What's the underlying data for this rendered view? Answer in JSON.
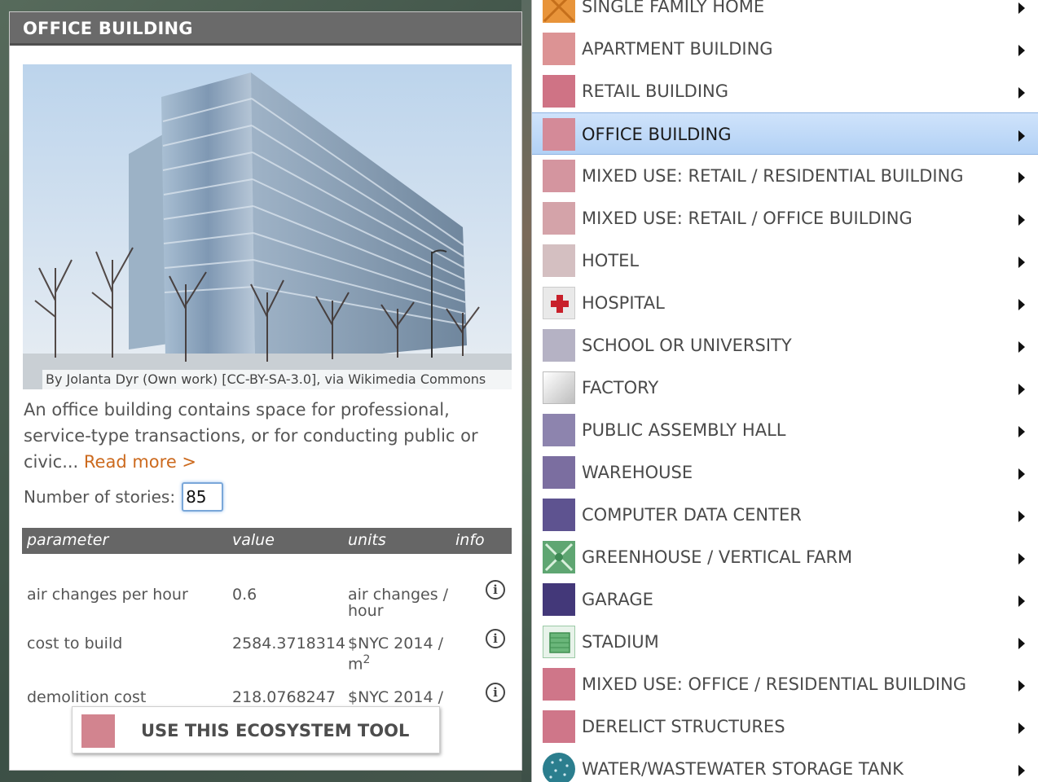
{
  "panel": {
    "title": "OFFICE BUILDING",
    "photo_credit": "By Jolanta Dyr (Own work) [CC-BY-SA-3.0], via Wikimedia Commons",
    "description": "An office building contains space for professional, service-type transactions, or for conducting public or civic...",
    "read_more": "Read more >",
    "stories_label": "Number of stories:",
    "stories_value": "85",
    "table": {
      "headers": [
        "parameter",
        "value",
        "units",
        "info"
      ],
      "rows": [
        {
          "parameter": "air changes per hour",
          "value": "0.6",
          "units_line1": "air changes /",
          "units_line2": "hour"
        },
        {
          "parameter": "cost to build",
          "value": "2584.3718314",
          "units_line1": "$NYC 2014 /",
          "units_line2": "m",
          "units_sup": "2"
        },
        {
          "parameter": "demolition cost",
          "value": "218.0768247",
          "units_line1": "$NYC 2014 /",
          "units_line2": ""
        }
      ]
    },
    "use_tool_label": "USE THIS ECOSYSTEM TOOL",
    "use_tool_color": "#d2848f"
  },
  "menu": {
    "items": [
      {
        "label": "SINGLE FAMILY HOME",
        "color": "#e8943a",
        "icon": "house-icon"
      },
      {
        "label": "APARTMENT BUILDING",
        "color": "#dc9394",
        "icon": "swatch"
      },
      {
        "label": "RETAIL BUILDING",
        "color": "#cf7385",
        "icon": "swatch"
      },
      {
        "label": "OFFICE BUILDING",
        "color": "#d48a98",
        "icon": "swatch",
        "selected": true
      },
      {
        "label": "MIXED USE: RETAIL / RESIDENTIAL BUILDING",
        "color": "#d4959f",
        "icon": "swatch"
      },
      {
        "label": "MIXED USE: RETAIL / OFFICE BUILDING",
        "color": "#d4a3a9",
        "icon": "swatch"
      },
      {
        "label": "HOTEL",
        "color": "#d4bfc1",
        "icon": "swatch"
      },
      {
        "label": "HOSPITAL",
        "color": "#e9e9e9",
        "icon": "red-cross-icon"
      },
      {
        "label": "SCHOOL OR UNIVERSITY",
        "color": "#b5b2c4",
        "icon": "swatch"
      },
      {
        "label": "FACTORY",
        "color": "#e2e2e2",
        "icon": "gradient"
      },
      {
        "label": "PUBLIC ASSEMBLY HALL",
        "color": "#8d84ae",
        "icon": "swatch"
      },
      {
        "label": "WAREHOUSE",
        "color": "#7b6ea0",
        "icon": "swatch"
      },
      {
        "label": "COMPUTER DATA CENTER",
        "color": "#5e5390",
        "icon": "swatch"
      },
      {
        "label": "GREENHOUSE / VERTICAL FARM",
        "color": "#5fa672",
        "icon": "greenhouse-icon"
      },
      {
        "label": "GARAGE",
        "color": "#433879",
        "icon": "swatch"
      },
      {
        "label": "STADIUM",
        "color": "#6ab67a",
        "icon": "stadium-icon"
      },
      {
        "label": "MIXED USE: OFFICE / RESIDENTIAL BUILDING",
        "color": "#cf7689",
        "icon": "swatch"
      },
      {
        "label": "DERELICT STRUCTURES",
        "color": "#cf7689",
        "icon": "swatch"
      },
      {
        "label": "WATER/WASTEWATER STORAGE TANK",
        "color": "#2b7e8e",
        "icon": "tank-icon"
      }
    ]
  }
}
